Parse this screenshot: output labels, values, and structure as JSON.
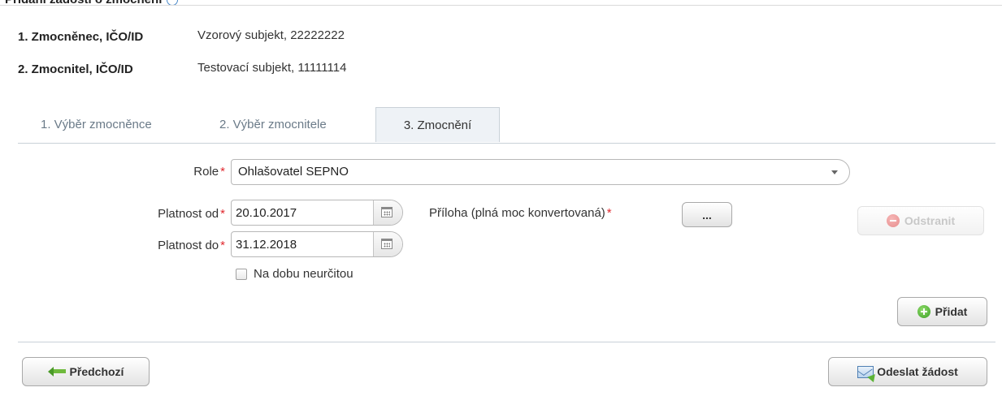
{
  "header": {
    "title": "Přidání žádosti o zmocnění"
  },
  "info": {
    "attorney_label": "1. Zmocněnec, IČO/ID",
    "attorney_value": "Vzorový subjekt, 22222222",
    "principal_label": "2. Zmocnitel, IČO/ID",
    "principal_value": "Testovací subjekt, 11111114"
  },
  "tabs": [
    {
      "label": "1. Výběr zmocněnce",
      "active": false
    },
    {
      "label": "2. Výběr zmocnitele",
      "active": false
    },
    {
      "label": "3. Zmocnění",
      "active": true
    }
  ],
  "form": {
    "required_marker": "*",
    "role_label": "Role",
    "role_value": "Ohlašovatel SEPNO",
    "valid_from_label": "Platnost od",
    "valid_from_value": "20.10.2017",
    "valid_to_label": "Platnost do",
    "valid_to_value": "31.12.2018",
    "indefinite_label": "Na dobu neurčitou",
    "indefinite_checked": false,
    "attachment_label": "Příloha (plná moc konvertovaná)",
    "browse_label": "...",
    "remove_label": "Odstranit",
    "add_label": "Přidat"
  },
  "footer": {
    "prev_label": "Předchozí",
    "submit_label": "Odeslat žádost"
  },
  "icons": {
    "info": "info-icon",
    "calendar": "calendar-icon",
    "add": "plus-circle-icon",
    "remove": "minus-circle-icon",
    "back": "arrow-left-icon",
    "send": "mail-send-icon"
  },
  "colors": {
    "required": "#e0282e",
    "tab_active_bg": "#eef2f6",
    "add_icon": "#3b9f25"
  }
}
